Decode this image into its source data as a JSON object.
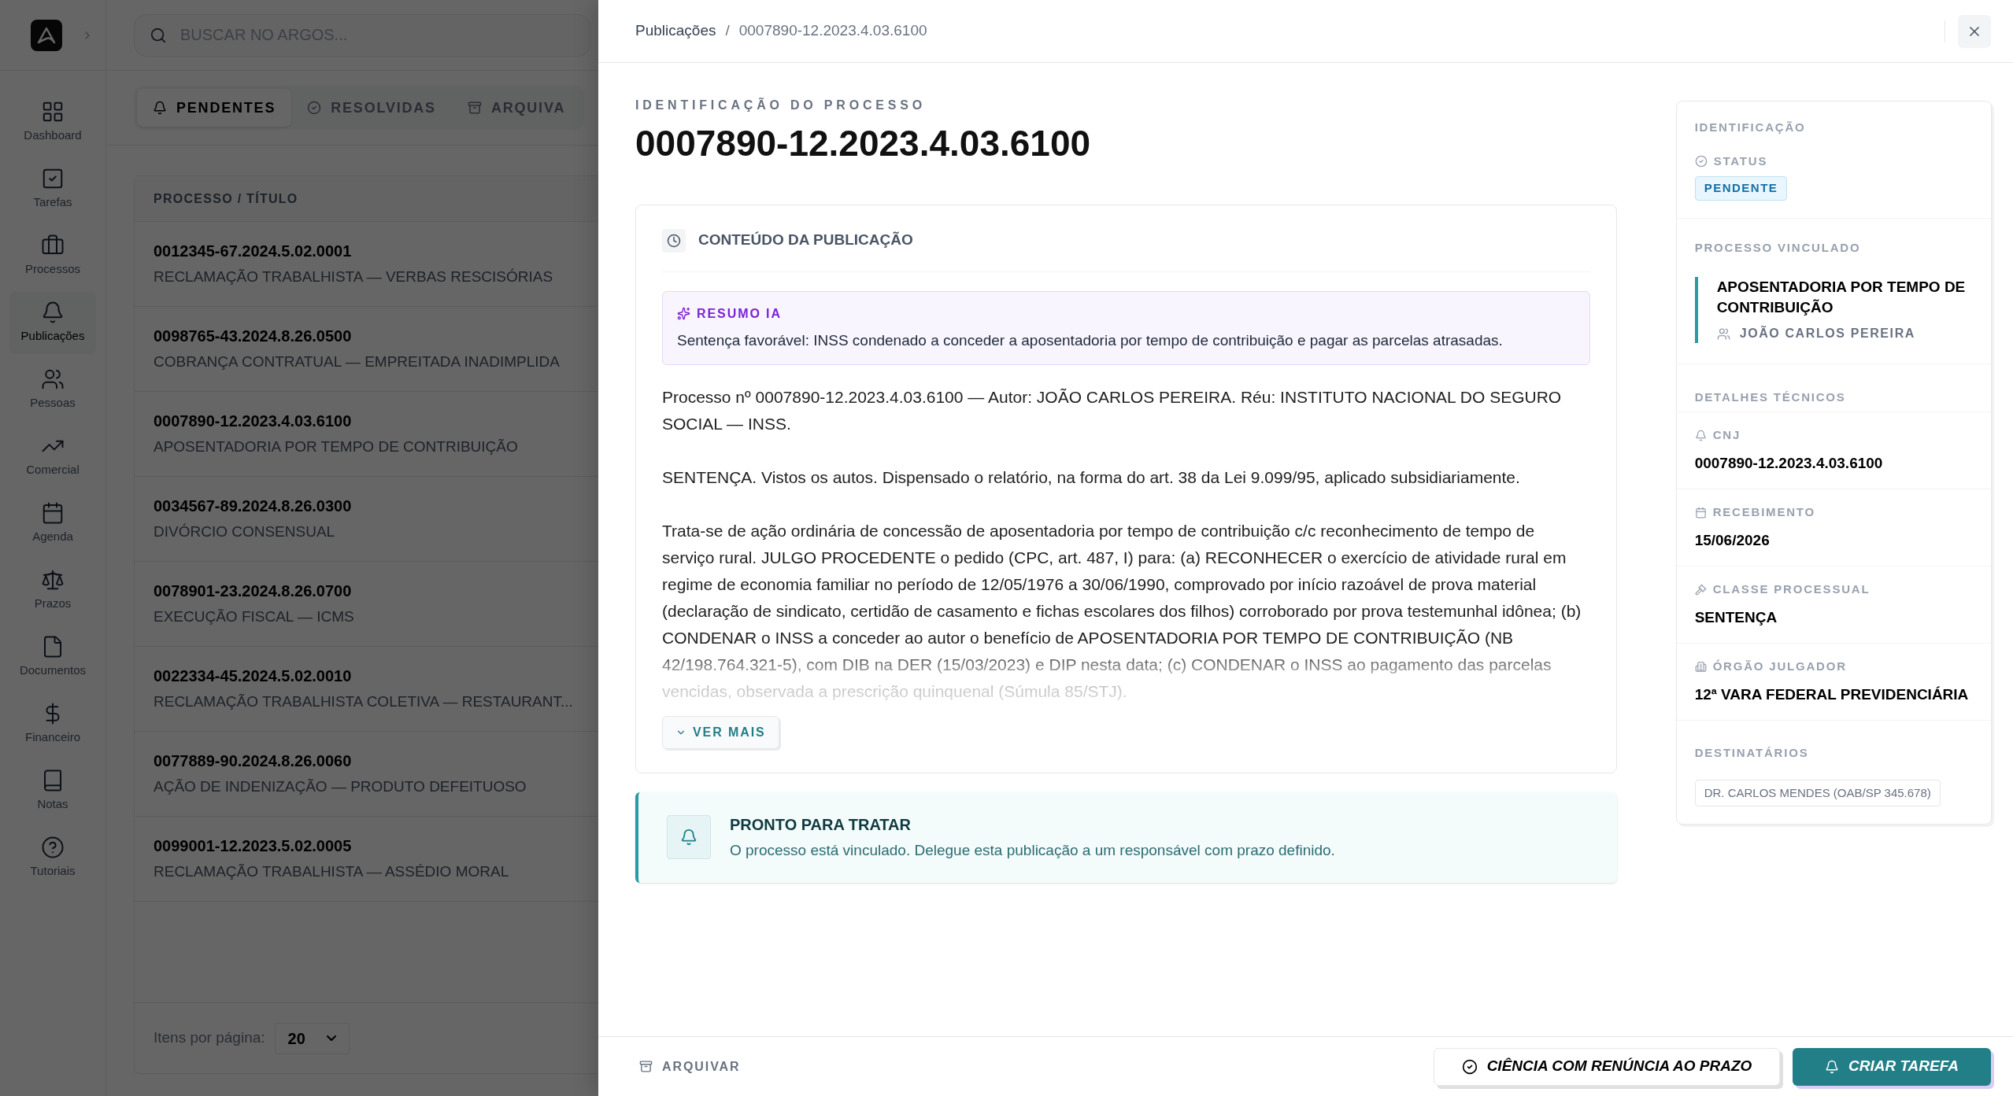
{
  "app": {
    "search": {
      "placeholder": "BUSCAR NO ARGOS..."
    },
    "nav": [
      {
        "label": "Dashboard",
        "selected": false
      },
      {
        "label": "Tarefas",
        "selected": false
      },
      {
        "label": "Processos",
        "selected": false
      },
      {
        "label": "Publicações",
        "selected": true
      },
      {
        "label": "Pessoas",
        "selected": false
      },
      {
        "label": "Comercial",
        "selected": false
      },
      {
        "label": "Agenda",
        "selected": false
      },
      {
        "label": "Prazos",
        "selected": false
      },
      {
        "label": "Documentos",
        "selected": false
      },
      {
        "label": "Financeiro",
        "selected": false
      },
      {
        "label": "Notas",
        "selected": false
      },
      {
        "label": "Tutoriais",
        "selected": false
      }
    ],
    "tabs": [
      {
        "label": "PENDENTES",
        "selected": true
      },
      {
        "label": "RESOLVIDAS",
        "selected": false
      },
      {
        "label": "ARQUIVA",
        "selected": false
      }
    ],
    "table": {
      "columns": [
        "PROCESSO / TÍTULO"
      ],
      "rows": [
        {
          "code": "0012345-67.2024.5.02.0001",
          "title": "RECLAMAÇÃO TRABALHISTA — VERBAS RESCISÓRIAS"
        },
        {
          "code": "0098765-43.2024.8.26.0500",
          "title": "COBRANÇA CONTRATUAL — EMPREITADA INADIMPLIDA"
        },
        {
          "code": "0007890-12.2023.4.03.6100",
          "title": "APOSENTADORIA POR TEMPO DE CONTRIBUIÇÃO"
        },
        {
          "code": "0034567-89.2024.8.26.0300",
          "title": "DIVÓRCIO CONSENSUAL"
        },
        {
          "code": "0078901-23.2024.8.26.0700",
          "title": "EXECUÇÃO FISCAL — ICMS"
        },
        {
          "code": "0022334-45.2024.5.02.0010",
          "title": "RECLAMAÇÃO TRABALHISTA COLETIVA — RESTAURANT..."
        },
        {
          "code": "0077889-90.2024.8.26.0060",
          "title": "AÇÃO DE INDENIZAÇÃO — PRODUTO DEFEITUOSO"
        },
        {
          "code": "0099001-12.2023.5.02.0005",
          "title": "RECLAMAÇÃO TRABALHISTA — ASSÉDIO MORAL"
        }
      ]
    },
    "pagination": {
      "label": "Itens por página:",
      "value": "20"
    }
  },
  "drawer": {
    "breadcrumb": [
      "Publicações",
      "/",
      "0007890-12.2023.4.03.6100"
    ],
    "eyebrow": "IDENTIFICAÇÃO DO PROCESSO",
    "title": "0007890-12.2023.4.03.6100",
    "content": {
      "heading": "CONTEÚDO DA PUBLICAÇÃO",
      "summary": {
        "label": "RESUMO IA",
        "text": "Sentença favorável: INSS condenado a conceder a aposentadoria por tempo de contribuição e pagar as parcelas atrasadas."
      },
      "paragraphs": [
        "Processo nº 0007890-12.2023.4.03.6100 — Autor: JOÃO CARLOS PEREIRA. Réu: INSTITUTO NACIONAL DO SEGURO SOCIAL — INSS.",
        "SENTENÇA. Vistos os autos. Dispensado o relatório, na forma do art. 38 da Lei 9.099/95, aplicado subsidiariamente.",
        "Trata-se de ação ordinária de concessão de aposentadoria por tempo de contribuição c/c reconhecimento de tempo de serviço rural. JULGO PROCEDENTE o pedido (CPC, art. 487, I) para: (a) RECONHECER o exercício de atividade rural em regime de economia familiar no período de 12/05/1976 a 30/06/1990, comprovado por início razoável de prova material (declaração de sindicato, certidão de casamento e fichas escolares dos filhos) corroborado por prova testemunhal idônea; (b) CONDENAR o INSS a conceder ao autor o benefício de APOSENTADORIA POR TEMPO DE CONTRIBUIÇÃO (NB 42/198.764.321-5), com DIB na DER (15/03/2023) e DIP nesta data; (c) CONDENAR o INSS ao pagamento das parcelas vencidas, observada a prescrição quinquenal (Súmula 85/STJ)."
      ],
      "more": "VER MAIS"
    },
    "alert": {
      "title": "PRONTO PARA TRATAR",
      "text": "O processo está vinculado. Delegue esta publicação a um responsável com prazo definido."
    },
    "side": {
      "identification": "IDENTIFICAÇÃO",
      "status_label": "STATUS",
      "status": "PENDENTE",
      "linked_heading": "PROCESSO VINCULADO",
      "linked_title": "APOSENTADORIA POR TEMPO DE CONTRIBUIÇÃO",
      "linked_person": "JOÃO CARLOS PEREIRA",
      "tech_heading": "DETALHES TÉCNICOS",
      "fields": [
        {
          "label": "CNJ",
          "value": "0007890-12.2023.4.03.6100"
        },
        {
          "label": "RECEBIMENTO",
          "value": "15/06/2026"
        },
        {
          "label": "CLASSE PROCESSUAL",
          "value": "SENTENÇA"
        },
        {
          "label": "ÓRGÃO JULGADOR",
          "value": "12ª VARA FEDERAL PREVIDENCIÁRIA"
        }
      ],
      "recipients_heading": "DESTINATÁRIOS",
      "recipients": [
        "DR. CARLOS MENDES (OAB/SP 345.678)"
      ]
    },
    "footer": {
      "archive": "ARQUIVAR",
      "secondary": "CIÊNCIA COM RENÚNCIA AO PRAZO",
      "primary": "CRIAR TAREFA"
    }
  }
}
